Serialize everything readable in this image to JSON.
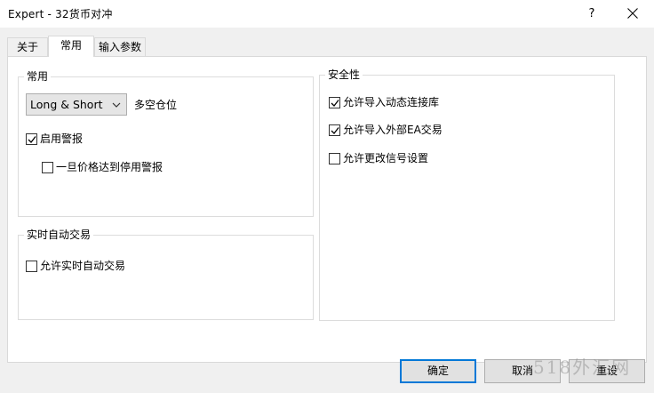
{
  "window": {
    "title": "Expert - 32货币对冲",
    "help_label": "?"
  },
  "tabs": [
    {
      "label": "关于",
      "active": false
    },
    {
      "label": "常用",
      "active": true
    },
    {
      "label": "输入参数",
      "active": false
    }
  ],
  "common_group": {
    "title": "常用",
    "position_mode": {
      "selected": "Long & Short",
      "label": "多空仓位"
    },
    "enable_alert": {
      "label": "启用警报",
      "checked": true
    },
    "disable_alert_on_price": {
      "label": "一旦价格达到停用警报",
      "checked": false
    }
  },
  "live_trading_group": {
    "title": "实时自动交易",
    "allow_live_trading": {
      "label": "允许实时自动交易",
      "checked": false
    }
  },
  "safety_group": {
    "title": "安全性",
    "allow_dll_imports": {
      "label": "允许导入动态连接库",
      "checked": true
    },
    "allow_external_ea_imports": {
      "label": "允许导入外部EA交易",
      "checked": true
    },
    "allow_signal_settings_change": {
      "label": "允许更改信号设置",
      "checked": false
    }
  },
  "buttons": {
    "ok": "确定",
    "cancel": "取消",
    "reset": "重设"
  },
  "watermark": "518外汇网"
}
